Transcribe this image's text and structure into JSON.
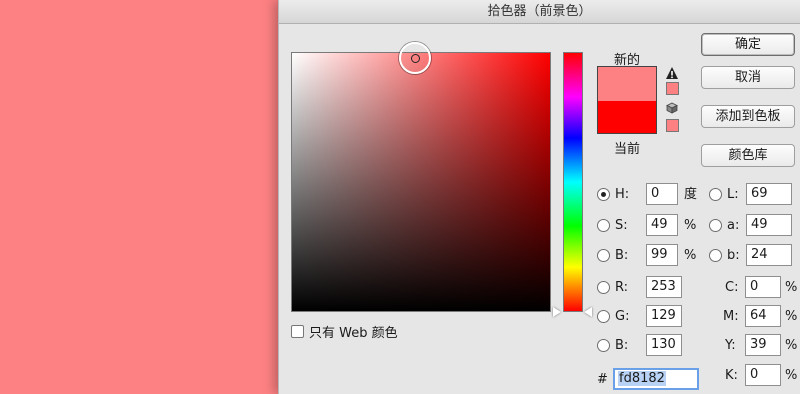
{
  "background_color": "#fd8182",
  "dialog": {
    "title": "拾色器（前景色）"
  },
  "swatches": {
    "new_label": "新的",
    "current_label": "当前",
    "new_color": "#fd8182",
    "current_color": "#ff0000"
  },
  "buttons": {
    "ok": "确定",
    "cancel": "取消",
    "add_to_swatches": "添加到色板",
    "color_libraries": "颜色库"
  },
  "web_only_label": "只有 Web 颜色",
  "hsb": {
    "h": {
      "label": "H:",
      "value": "0",
      "unit": "度",
      "selected": true
    },
    "s": {
      "label": "S:",
      "value": "49",
      "unit": "%"
    },
    "b": {
      "label": "B:",
      "value": "99",
      "unit": "%"
    }
  },
  "rgb": {
    "r": {
      "label": "R:",
      "value": "253"
    },
    "g": {
      "label": "G:",
      "value": "129"
    },
    "b": {
      "label": "B:",
      "value": "130"
    }
  },
  "lab": {
    "l": {
      "label": "L:",
      "value": "69"
    },
    "a": {
      "label": "a:",
      "value": "49"
    },
    "b": {
      "label": "b:",
      "value": "24"
    }
  },
  "cmyk": {
    "c": {
      "label": "C:",
      "value": "0",
      "unit": "%"
    },
    "m": {
      "label": "M:",
      "value": "64",
      "unit": "%"
    },
    "y": {
      "label": "Y:",
      "value": "39",
      "unit": "%"
    },
    "k": {
      "label": "K:",
      "value": "0",
      "unit": "%"
    }
  },
  "hex": {
    "prefix": "#",
    "value": "fd8182"
  }
}
